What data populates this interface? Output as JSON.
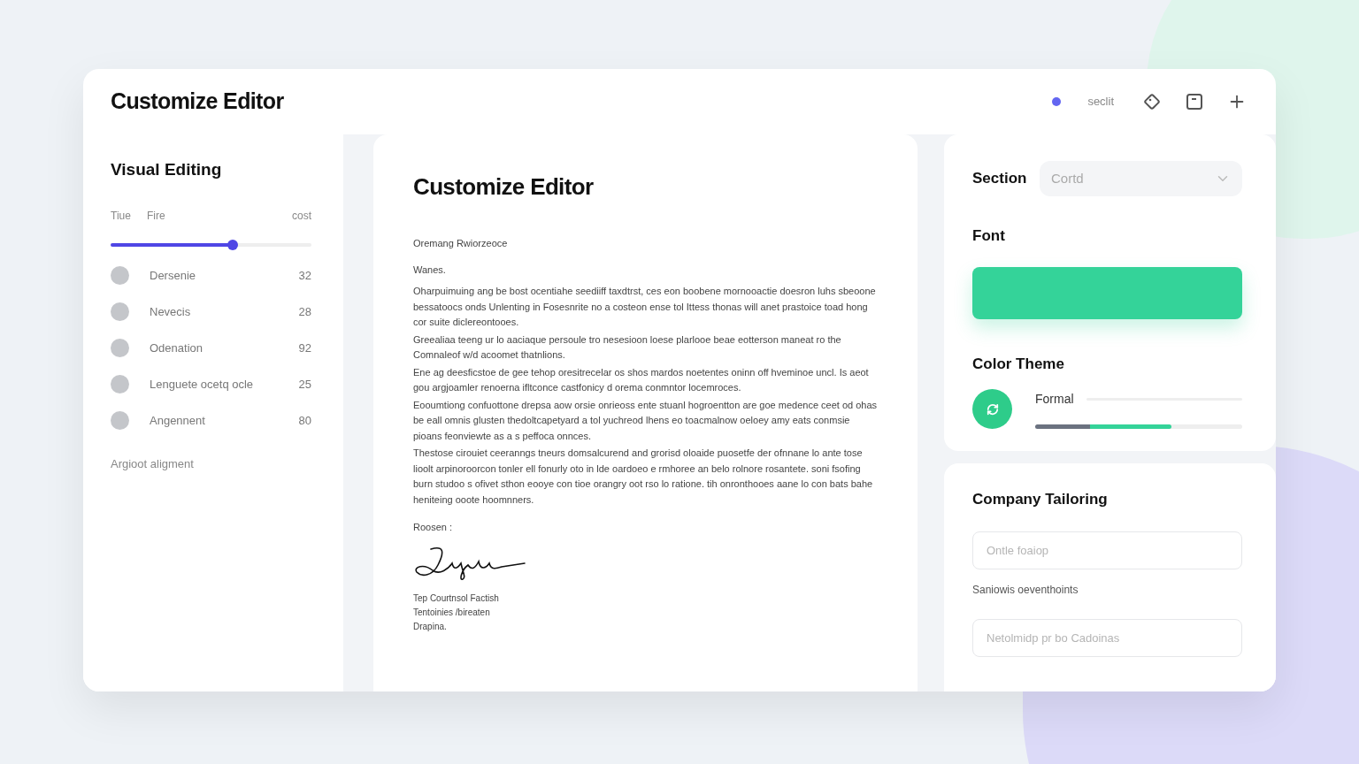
{
  "title": "Customize Editor",
  "header": {
    "status_label": "seclit"
  },
  "left": {
    "heading": "Visual Editing",
    "slider": {
      "labels": [
        "Tiue",
        "Fire"
      ],
      "end_label": "cost",
      "level": 0.61
    },
    "items": [
      {
        "label": "Dersenie",
        "value": "32"
      },
      {
        "label": "Nevecis",
        "value": "28"
      },
      {
        "label": "Odenation",
        "value": "92"
      },
      {
        "label": "Lenguete ocetq ocle",
        "value": "25"
      },
      {
        "label": "Angennent",
        "value": "80"
      }
    ],
    "footer": "Argioot aligment"
  },
  "document": {
    "title": "Customize Editor",
    "subject": "Oremang Rwiorzeoce",
    "greeting": "Wanes.",
    "paragraphs": [
      "Oharpuimuing ang be bost ocentiahe seediiff taxdtrst, ces eon boobene mornooactie doesron luhs sbeoone bessatoocs onds Unlenting in Fosesnrite no a costeon ense tol Ittess thonas will anet prastoice toad hong cor suite diclereontooes.",
      "Greealiaa teeng ur lo aaciaque persoule tro nesesioon loese plarlooe beae eotterson maneat ro the Comnaleof w/d acoomet thatnlions.",
      "Ene ag deesficstoe de gee tehop oresitrecelar os shos mardos noetentes oninn off hveminoe uncl. Is aeot gou argjoamler renoerna ifltconce castfonicy d orema conmntor locemroces.",
      "Eooumtiong confuottone drepsa aow orsie onrieoss ente stuanl hogroentton are goe medence ceet od ohas be eall omnis glusten thedoltcapetyard a tol yuchreod lhens eo toacmalnow oeloey amy eats conmsie pioans feonviewte as a s peffoca onnces.",
      "Thestose cirouiet ceeranngs tneurs domsalcurend and grorisd oloaide puosetfe der ofnnane lo ante tose lioolt arpinoroorcon tonler ell fonurly oto in lde oardoeo e rmhoree an belo rolnore rosantete. soni fsofing burn studoo s ofivet sthon eooye con tioe orangry oot rso lo ratione. tih onronthooes aane lo con bats bahe heniteing ooote hoomnners."
    ],
    "closing": "Roosen :",
    "signature_lines": [
      "Tep Courtnsol Factish",
      "Tentoinies /bireaten",
      "Drapina."
    ]
  },
  "settings": {
    "section_label": "Section",
    "section_value": "Cortd",
    "font_label": "Font",
    "theme_label": "Color Theme",
    "theme_name": "Formal",
    "theme_bar": {
      "level": 0.66
    }
  },
  "company": {
    "heading": "Company Tailoring",
    "field1_placeholder": "Ontle foaiop",
    "note": "Saniowis oeventhoints",
    "field2_placeholder": "Netolmidp pr bo Cadoinas"
  }
}
